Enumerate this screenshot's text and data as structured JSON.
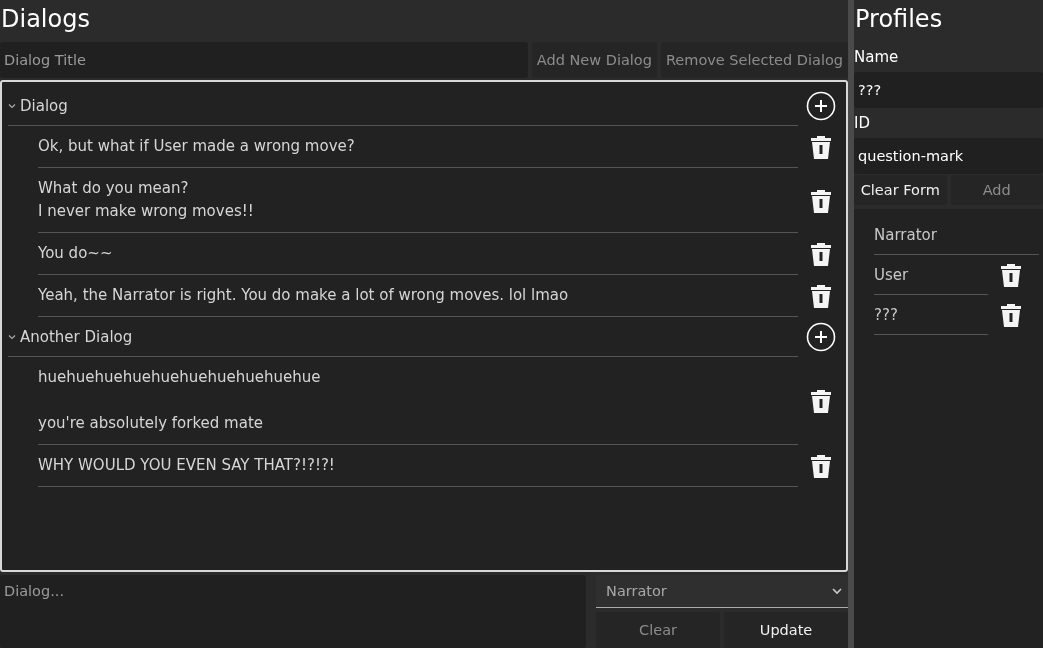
{
  "dialogs": {
    "title": "Dialogs",
    "title_field": {
      "placeholder": "Dialog Title"
    },
    "buttons": [
      {
        "label": "Add New Dialog",
        "disabled": true
      },
      {
        "label": "Remove Selected Dialog",
        "disabled": true
      }
    ],
    "tree": [
      {
        "title": "Dialog",
        "expanded": true,
        "lines": [
          {
            "text": "Ok, but what if User made a wrong move?"
          },
          {
            "text": "What do you mean?\nI never make wrong moves!!"
          },
          {
            "text": "You do~~"
          },
          {
            "text": "Yeah, the Narrator is right. You do make a lot of wrong moves. lol lmao"
          }
        ]
      },
      {
        "title": "Another Dialog",
        "expanded": true,
        "lines": [
          {
            "text": "huehuehuehuehuehuehuehuehuehue\n\nyou're absolutely forked mate"
          },
          {
            "text": "WHY WOULD YOU EVEN SAY THAT?!?!?!"
          }
        ]
      }
    ],
    "editor": {
      "placeholder": "Dialog...",
      "speaker": "Narrator",
      "buttons": [
        {
          "label": "Clear",
          "disabled": true
        },
        {
          "label": "Update",
          "disabled": false
        }
      ]
    }
  },
  "profiles": {
    "title": "Profiles",
    "name_label": "Name",
    "name_value": "???",
    "id_label": "ID",
    "id_value": "question-mark",
    "buttons": [
      {
        "label": "Clear Form",
        "disabled": false
      },
      {
        "label": "Add",
        "disabled": true
      }
    ],
    "list": [
      {
        "name": "Narrator",
        "removable": false
      },
      {
        "name": "User",
        "removable": true
      },
      {
        "name": "???",
        "removable": true
      }
    ]
  }
}
